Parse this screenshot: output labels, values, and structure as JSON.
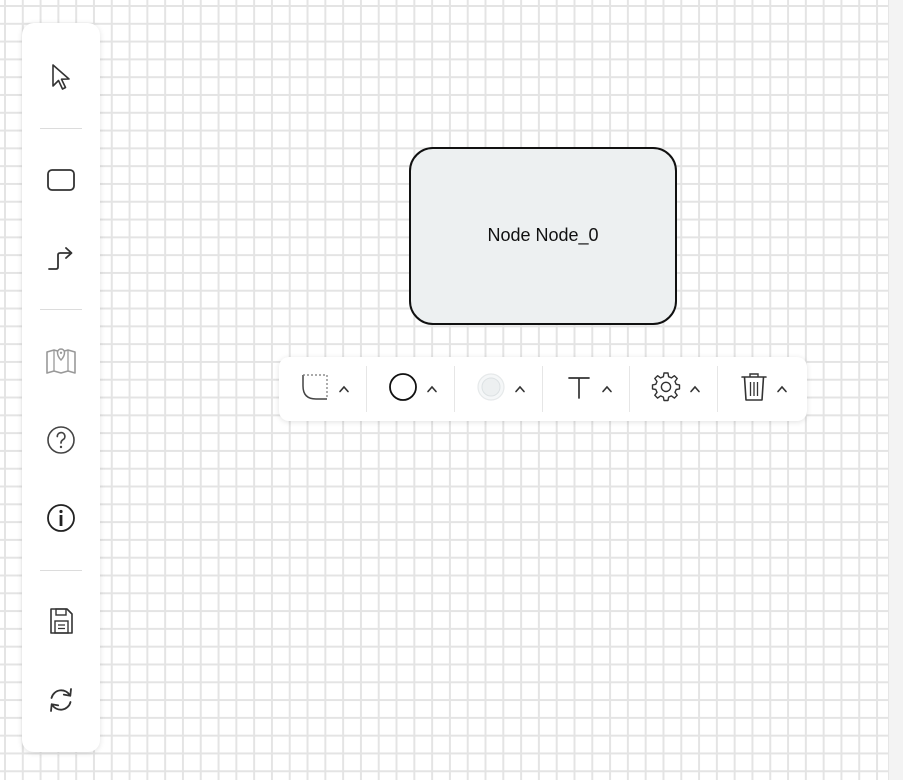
{
  "sidebar": {
    "tools": [
      {
        "name": "select-tool",
        "icon": "pointer-icon"
      },
      {
        "name": "rectangle-tool",
        "icon": "rectangle-icon"
      },
      {
        "name": "connector-tool",
        "icon": "elbow-arrow-icon"
      },
      {
        "name": "map-tool",
        "icon": "map-pin-icon"
      },
      {
        "name": "help-tool",
        "icon": "question-circle-icon"
      },
      {
        "name": "info-tool",
        "icon": "info-circle-icon"
      },
      {
        "name": "save-tool",
        "icon": "floppy-disk-icon"
      },
      {
        "name": "refresh-tool",
        "icon": "refresh-icon"
      }
    ]
  },
  "node": {
    "label": "Node Node_0",
    "fill_color": "#edf0f1",
    "stroke_color": "#111111"
  },
  "properties_toolbar": {
    "groups": [
      {
        "name": "corner-radius",
        "icon": "corner-radius-icon"
      },
      {
        "name": "border-color",
        "icon": "circle-outline-icon"
      },
      {
        "name": "fill-color",
        "icon": "fill-swatch-icon",
        "color": "#edf0f1"
      },
      {
        "name": "text-style",
        "icon": "text-t-icon"
      },
      {
        "name": "settings",
        "icon": "gear-icon"
      },
      {
        "name": "delete",
        "icon": "trash-icon"
      }
    ]
  },
  "colors": {
    "grid_line": "#e4e4e4",
    "icon": "#333333",
    "divider": "#dcdcdc"
  }
}
